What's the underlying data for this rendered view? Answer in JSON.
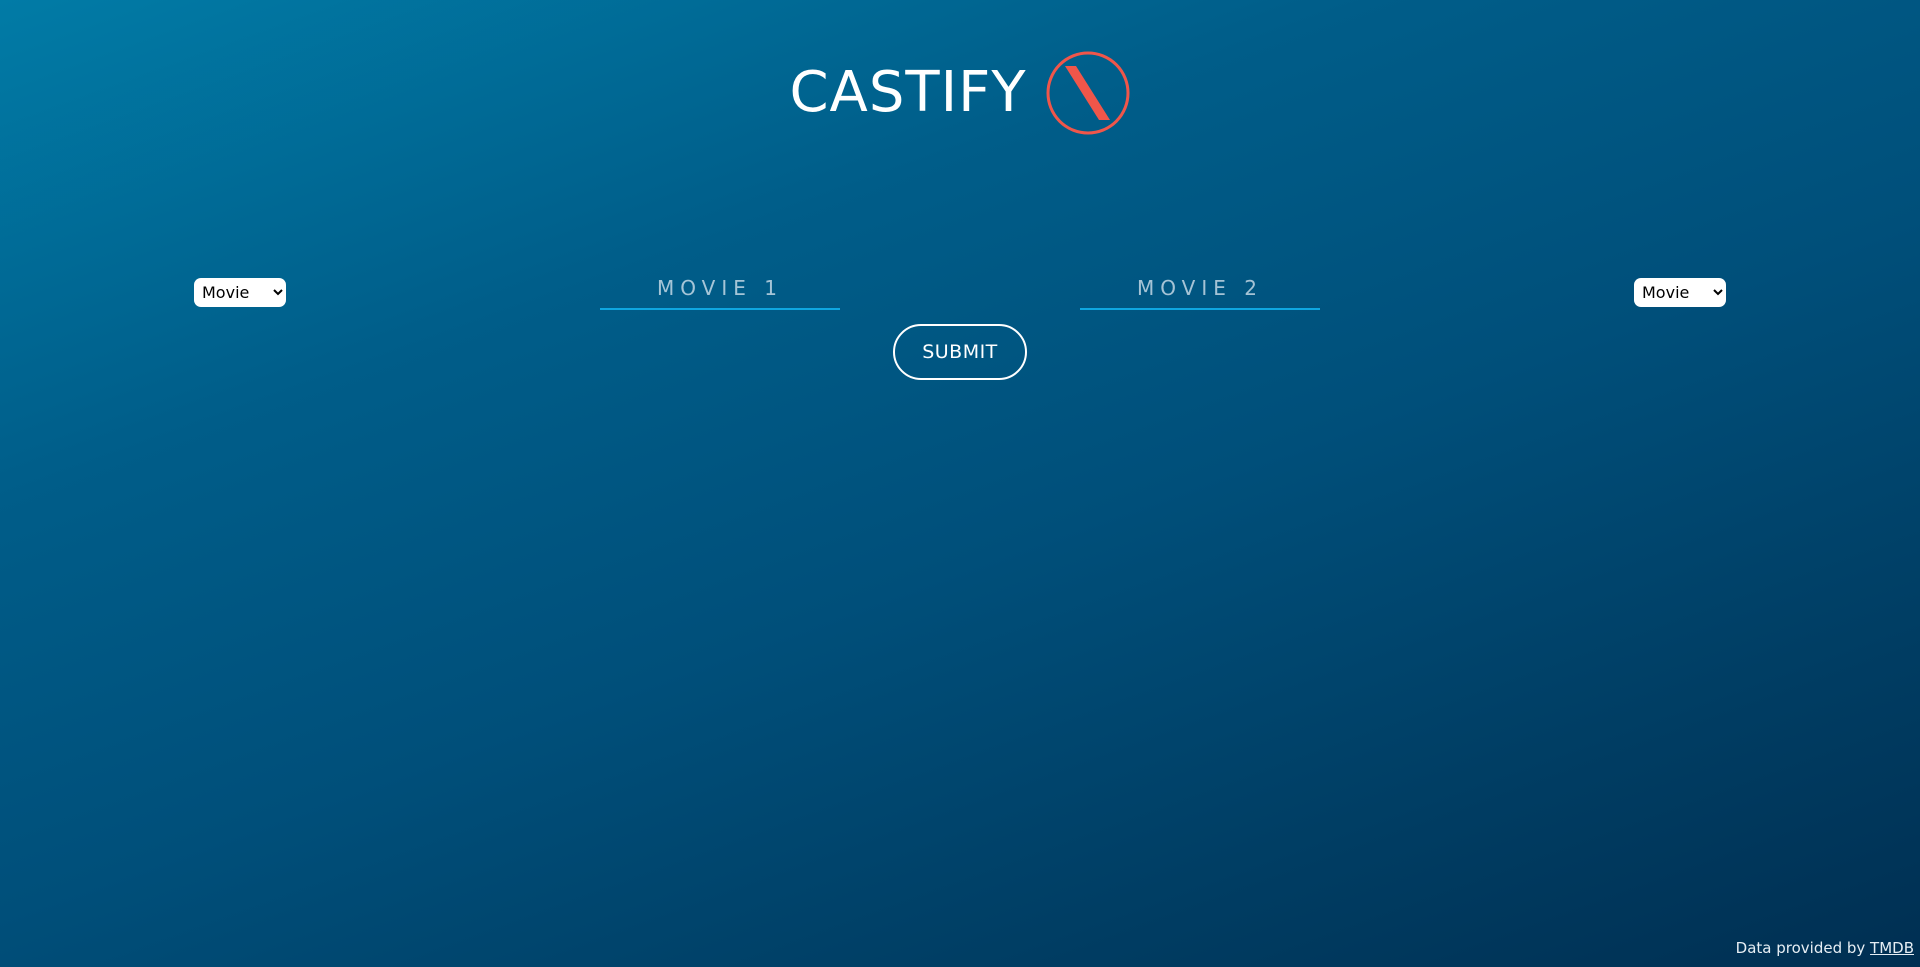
{
  "brand": {
    "name": "CASTIFY",
    "logo_icon": "castify-logo-icon",
    "logo_color": "#f0564a"
  },
  "search": {
    "left_type": {
      "selected": "Movie",
      "options": [
        "Movie"
      ]
    },
    "right_type": {
      "selected": "Movie",
      "options": [
        "Movie"
      ]
    },
    "movie1_placeholder": "MOVIE 1",
    "movie2_placeholder": "MOVIE 2",
    "submit_label": "SUBMIT"
  },
  "footer": {
    "prefix": "Data provided by ",
    "link_label": "TMDB"
  },
  "colors": {
    "background_top": "#017ba6",
    "background_bottom": "#002f52",
    "input_underline": "#0fa6e0"
  }
}
